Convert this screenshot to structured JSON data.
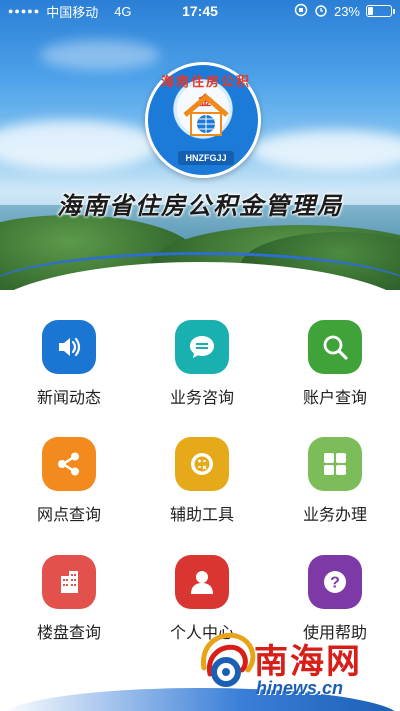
{
  "status_bar": {
    "signal": "●●●●●",
    "carrier": "中国移动",
    "network": "4G",
    "time": "17:45",
    "battery_percent": "23%",
    "battery_level": 0.23
  },
  "header": {
    "logo_arc_text": "海南住房公积金",
    "logo_tag": "HNZFGJJ",
    "org_title": "海南省住房公积金管理局"
  },
  "menu": {
    "items": [
      {
        "label": "新闻动态",
        "icon": "speaker-icon",
        "color": "#1a76d2"
      },
      {
        "label": "业务咨询",
        "icon": "chat-bubble-icon",
        "color": "#1ab0b0"
      },
      {
        "label": "账户查询",
        "icon": "search-icon",
        "color": "#3fa33a"
      },
      {
        "label": "网点查询",
        "icon": "share-nodes-icon",
        "color": "#f28a1e"
      },
      {
        "label": "辅助工具",
        "icon": "tools-icon",
        "color": "#e5a91a"
      },
      {
        "label": "业务办理",
        "icon": "grid-icon",
        "color": "#7cbd5a"
      },
      {
        "label": "楼盘查询",
        "icon": "building-icon",
        "color": "#e2514b"
      },
      {
        "label": "个人中心",
        "icon": "person-icon",
        "color": "#d93632"
      },
      {
        "label": "使用帮助",
        "icon": "question-icon",
        "color": "#7d3aa6"
      }
    ]
  },
  "watermark": {
    "name": "南海网",
    "url": "hinews.cn"
  }
}
